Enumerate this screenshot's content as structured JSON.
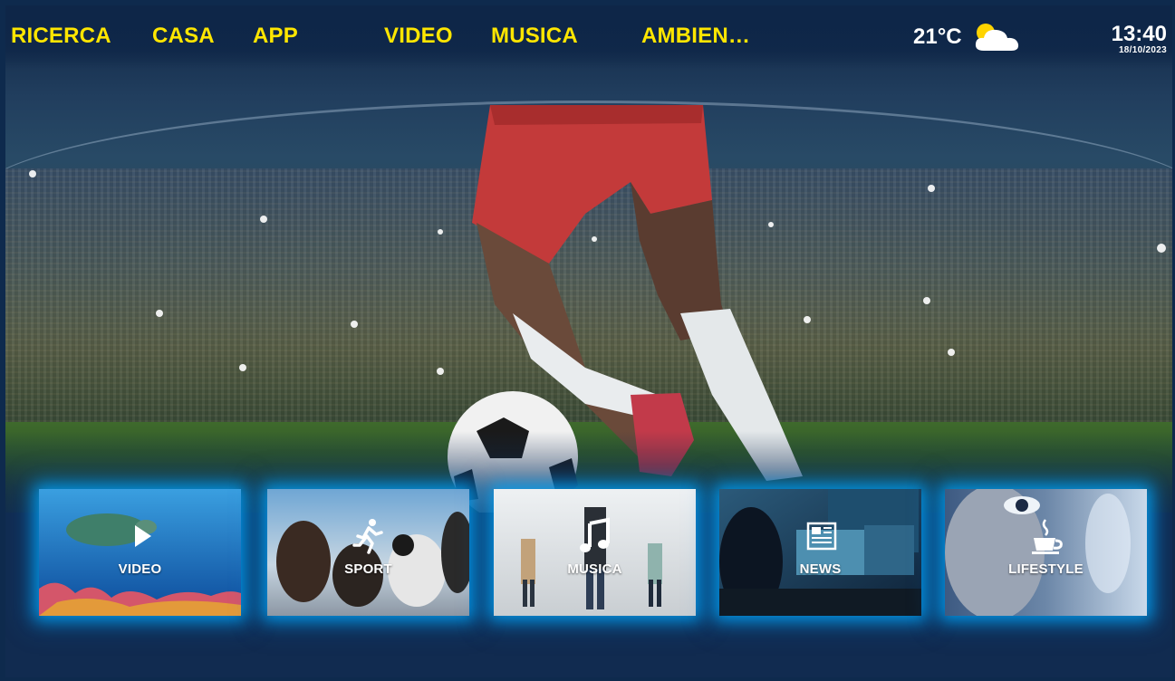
{
  "nav": {
    "items": [
      {
        "label": "RICERCA"
      },
      {
        "label": "CASA"
      },
      {
        "label": "APP"
      },
      {
        "label": "VIDEO"
      },
      {
        "label": "MUSICA"
      },
      {
        "label": "AMBIEN…"
      }
    ],
    "accent_color": "#ffe600"
  },
  "weather": {
    "temperature": "21°C",
    "icon": "partly-cloudy-icon"
  },
  "clock": {
    "time": "13:40",
    "date": "18/10/2023"
  },
  "hero": {
    "image": "soccer-player-stadium"
  },
  "tiles": [
    {
      "label": "VIDEO",
      "icon": "play-icon"
    },
    {
      "label": "SPORT",
      "icon": "running-person-icon"
    },
    {
      "label": "MUSICA",
      "icon": "music-note-icon"
    },
    {
      "label": "NEWS",
      "icon": "newspaper-icon"
    },
    {
      "label": "LIFESTYLE",
      "icon": "coffee-cup-icon"
    }
  ],
  "colors": {
    "background": "#112b50",
    "tile_glow": "#00aaff"
  }
}
